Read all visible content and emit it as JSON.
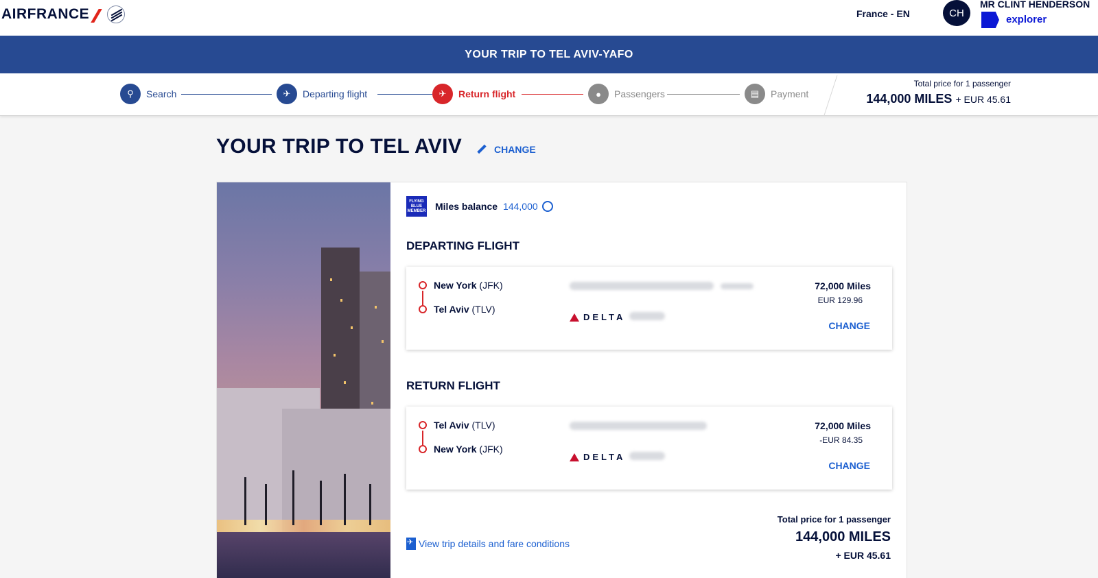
{
  "header": {
    "logo_text": "AIRFRANCE",
    "locale": "France - EN",
    "avatar_initials": "CH",
    "user_name": "MR CLINT HENDERSON",
    "tier": "explorer"
  },
  "banner": {
    "title": "YOUR TRIP TO TEL AVIV-YAFO"
  },
  "stepper": {
    "steps": [
      {
        "label": "Search",
        "state": "done"
      },
      {
        "label": "Departing flight",
        "state": "done"
      },
      {
        "label": "Return flight",
        "state": "current"
      },
      {
        "label": "Passengers",
        "state": "upcoming"
      },
      {
        "label": "Payment",
        "state": "upcoming"
      }
    ],
    "price_caption": "Total price for 1 passenger",
    "price_miles": "144,000 MILES",
    "price_eur": "+ EUR 45.61"
  },
  "page": {
    "title": "YOUR TRIP TO TEL AVIV",
    "change_label": "CHANGE"
  },
  "miles_balance": {
    "badge_text": "FLYING BLUE MEMBER",
    "label": "Miles balance",
    "value": "144,000"
  },
  "departing": {
    "section_title": "DEPARTING FLIGHT",
    "from_city": "New York",
    "from_code": "(JFK)",
    "to_city": "Tel Aviv",
    "to_code": "(TLV)",
    "airline": "DELTA",
    "miles": "72,000 Miles",
    "eur": "EUR 129.96",
    "change_label": "CHANGE"
  },
  "returning": {
    "section_title": "RETURN FLIGHT",
    "from_city": "Tel Aviv",
    "from_code": "(TLV)",
    "to_city": "New York",
    "to_code": "(JFK)",
    "airline": "DELTA",
    "miles": "72,000 Miles",
    "eur": "-EUR 84.35",
    "change_label": "CHANGE"
  },
  "footer": {
    "details_link": "View trip details and fare conditions",
    "total_caption": "Total price for 1 passenger",
    "total_miles": "144,000 MILES",
    "total_eur": "+ EUR 45.61"
  },
  "colors": {
    "navy": "#051039",
    "banner_blue": "#274a92",
    "link_blue": "#1b5fd0",
    "accent_red": "#d8262a",
    "step_grey": "#8a8a8a"
  }
}
